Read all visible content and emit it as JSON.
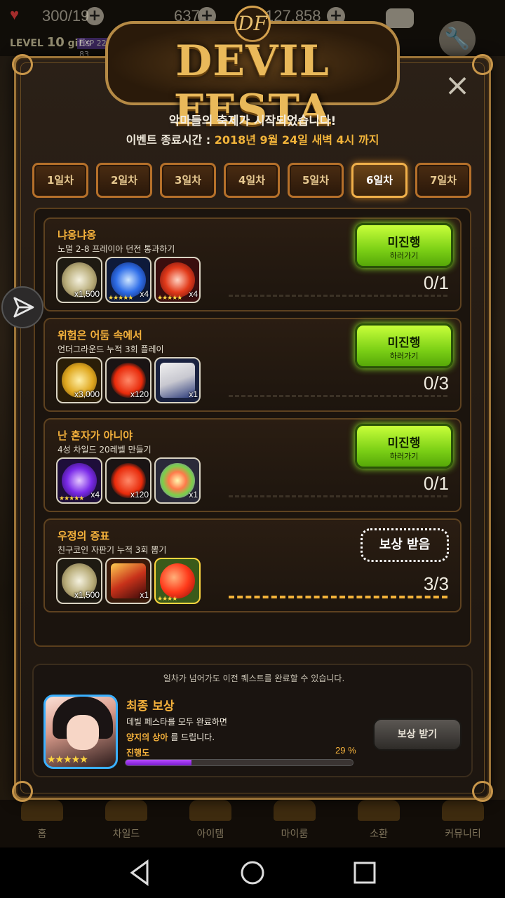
{
  "topbar": {
    "stamina": "300/19",
    "gems": "637",
    "gold": "127,858",
    "level_prefix": "LEVEL",
    "level_num": "10",
    "player_name": "gifis",
    "exp": "EXP 22 / 83"
  },
  "dialog": {
    "logo_title": "DEVIL FESTA",
    "logo_mark": "DF",
    "subtitle": "악마들의 축제가 시작되었습니다!",
    "end_label": "이벤트 종료시간 :",
    "end_value": "2018년 9월 24일 새벽 4시 까지",
    "close": "×"
  },
  "tabs": [
    {
      "label": "1일차"
    },
    {
      "label": "2일차"
    },
    {
      "label": "3일차"
    },
    {
      "label": "4일차"
    },
    {
      "label": "5일차"
    },
    {
      "label": "6일차",
      "active": true
    },
    {
      "label": "7일차"
    }
  ],
  "quests": [
    {
      "title": "냐옹냐옹",
      "desc": "노멀 2-8 프레이아 던전 통과하기",
      "items": [
        {
          "icon": "silver-coin-icon",
          "count": "x1,500",
          "stars": ""
        },
        {
          "icon": "blue-gem-icon",
          "count": "x4",
          "stars": "★★★★★"
        },
        {
          "icon": "red-gem-icon",
          "count": "x4",
          "stars": "★★★★★"
        }
      ],
      "progress": "0/1",
      "fraction": 0,
      "button_main": "미진행",
      "button_sub": "하러가기"
    },
    {
      "title": "위험은 어둠 속에서",
      "desc": "언더그라운드 누적 3회 플레이",
      "items": [
        {
          "icon": "gold-coins-icon",
          "count": "x3,000",
          "stars": ""
        },
        {
          "icon": "heart-icon",
          "count": "x120",
          "stars": ""
        },
        {
          "icon": "ticket-icon",
          "count": "x1",
          "stars": ""
        }
      ],
      "progress": "0/3",
      "fraction": 0,
      "button_main": "미진행",
      "button_sub": "하러가기"
    },
    {
      "title": "난 혼자가 아니야",
      "desc": "4성 차일드 20레벨 만들기",
      "items": [
        {
          "icon": "purple-gem-icon",
          "count": "x4",
          "stars": "★★★★★"
        },
        {
          "icon": "heart-icon",
          "count": "x120",
          "stars": ""
        },
        {
          "icon": "rainbow-orb-icon",
          "count": "x1",
          "stars": ""
        }
      ],
      "progress": "0/1",
      "fraction": 0,
      "button_main": "미진행",
      "button_sub": "하러가기"
    },
    {
      "title": "우정의 증표",
      "desc": "친구코인 자판기 누적 3회 뽑기",
      "items": [
        {
          "icon": "silver-coin-icon",
          "count": "x1,500",
          "stars": ""
        },
        {
          "icon": "card-pack-icon",
          "count": "x1",
          "stars": ""
        },
        {
          "icon": "red-slime-icon",
          "count": "",
          "stars": "★★★★"
        }
      ],
      "progress": "3/3",
      "fraction": 1,
      "button_main": "보상 받음",
      "button_sub": ""
    }
  ],
  "final": {
    "note": "일차가 넘어가도 이전 퀘스트를 완료할 수 있습니다.",
    "title": "최종 보상",
    "desc1": "데빌 페스타를 모두 완료하면",
    "desc2_hl": "양지의 상아",
    "desc2_rest": " 를 드립니다.",
    "progress_label": "진행도",
    "progress_pct": "29 %",
    "progress_value": 0.29,
    "stars": "★★★★★",
    "button": "보상 받기"
  },
  "bottomnav": [
    "홈",
    "차일드",
    "아이템",
    "마이룸",
    "소환",
    "커뮤니티"
  ],
  "colors": {
    "accent_gold": "#f5b23c",
    "button_green": "#7cd016",
    "progress_purple": "#9a2ee8"
  }
}
